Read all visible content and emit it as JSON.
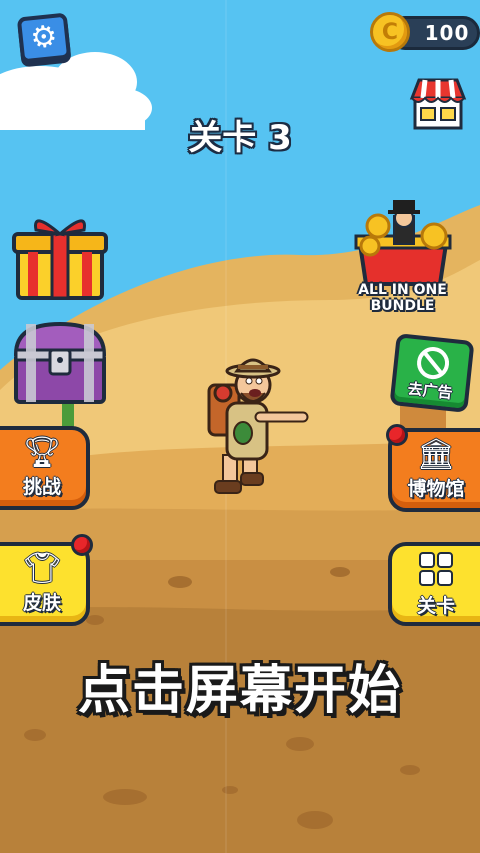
{
  "hud": {
    "coins": "100",
    "level_title": "关卡 3"
  },
  "left_menu": {
    "challenge_label": "挑战",
    "skins_label": "皮肤"
  },
  "right_menu": {
    "bundle_label": "ALL IN ONE BUNDLE",
    "no_ads_label": "去广告",
    "museum_label": "博物馆",
    "levels_label": "关卡"
  },
  "prompt": {
    "start_text": "点击屏幕开始"
  },
  "icons": {
    "settings": "gear-icon",
    "coin": "coin-icon",
    "shop": "shop-icon",
    "gift": "gift-icon",
    "chest": "chest-icon",
    "trophy": "trophy-icon",
    "shirt": "shirt-icon",
    "museum": "museum-icon",
    "grid": "grid-icon",
    "no_ads": "no-ads-icon"
  },
  "colors": {
    "sky": "#56c3f2",
    "sand": "#eec57a",
    "orange_button": "#f37d1e",
    "yellow_button": "#fde12e",
    "green_button": "#29b248",
    "outline": "#1f2b3d"
  }
}
